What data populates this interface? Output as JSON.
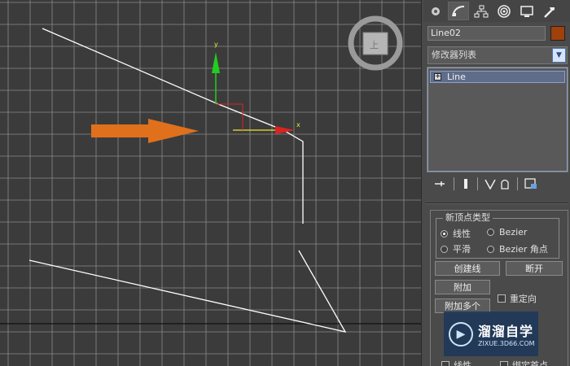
{
  "viewport": {
    "viewcube_label": "上",
    "gizmo_y_label": "y",
    "gizmo_x_label": "x",
    "colors": {
      "background": "#3b3b3b",
      "grid": "#8a8a8a",
      "line": "#ffffff",
      "arrow": "#e0701c",
      "gizmo_y": "#22cc22",
      "gizmo_x": "#dd2222"
    }
  },
  "command_panel": {
    "tabs": [
      {
        "icon": "create-icon",
        "label": ""
      },
      {
        "icon": "modify-icon",
        "label": ""
      },
      {
        "icon": "hierarchy-icon",
        "label": ""
      },
      {
        "icon": "motion-icon",
        "label": ""
      },
      {
        "icon": "display-icon",
        "label": ""
      },
      {
        "icon": "utilities-icon",
        "label": ""
      }
    ],
    "object_name": "Line02",
    "object_color": "#a0400a",
    "modifier_list": "修改器列表",
    "stack_item": "Line",
    "stack_tools": [
      "pin-stack-icon",
      "show-end-result-icon",
      "make-unique-icon",
      "remove-modifier-icon",
      "configure-sets-icon"
    ]
  },
  "rollout": {
    "group_title": "新顶点类型",
    "radios": [
      {
        "label": "线性",
        "checked": true
      },
      {
        "label": "Bezier",
        "checked": false
      },
      {
        "label": "平滑",
        "checked": false
      },
      {
        "label": "Bezier 角点",
        "checked": false
      }
    ],
    "create_line": "创建线",
    "break": "断开",
    "attach": "附加",
    "reorient": "重定向",
    "attach_multiple": "附加多个",
    "linear_chk": "线性",
    "bind_first_chk": "绑定首点"
  },
  "watermark": {
    "title": "溜溜自学",
    "url": "ZIXUE.3D66.COM"
  }
}
